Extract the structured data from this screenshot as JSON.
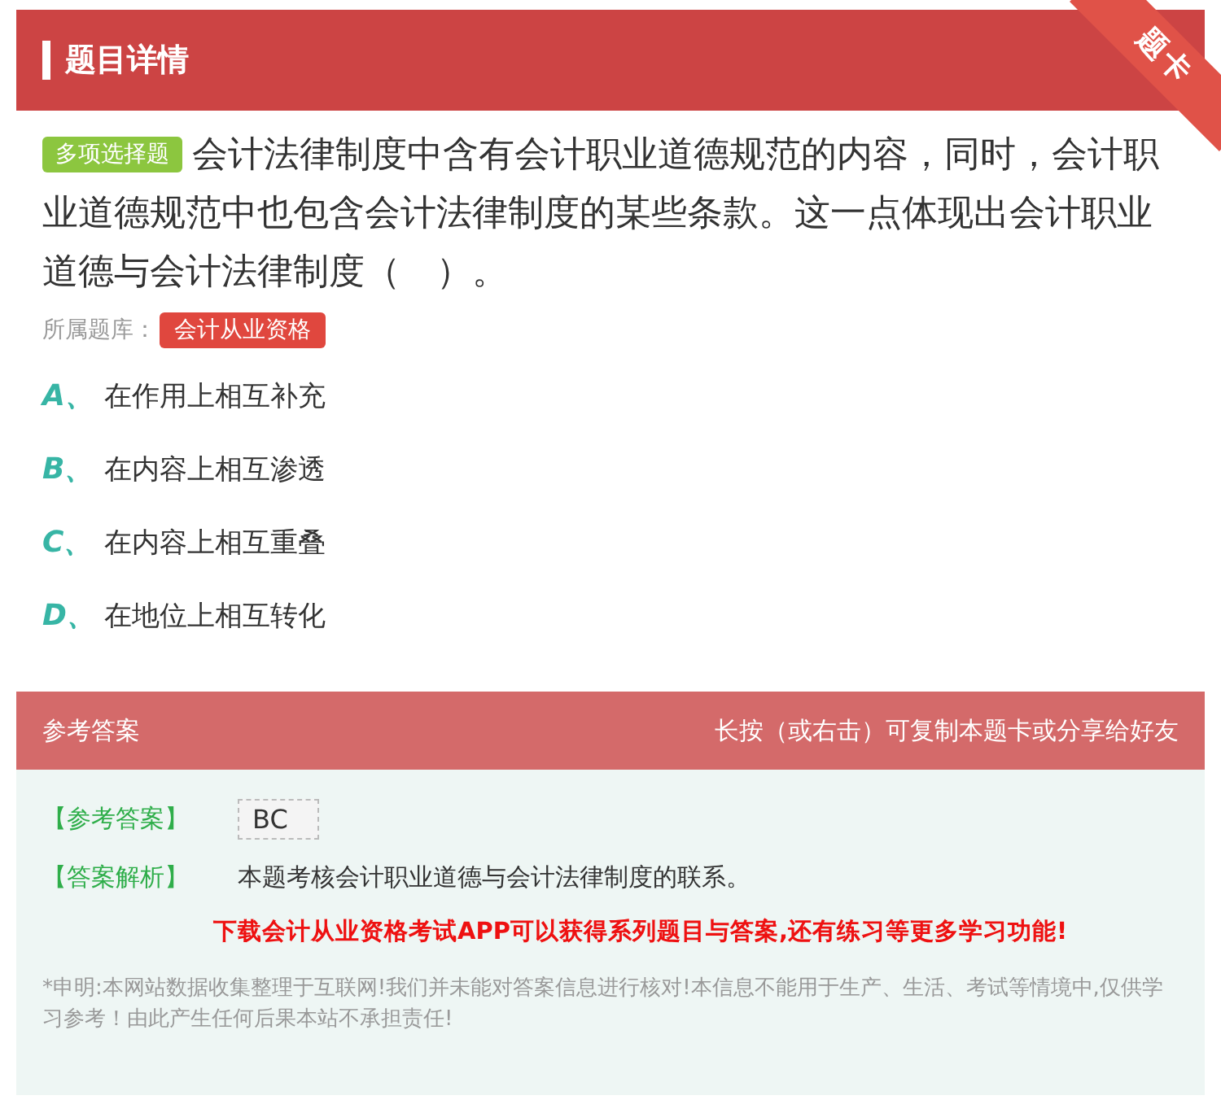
{
  "header": {
    "title": "题目详情",
    "corner_tag": "题卡"
  },
  "question": {
    "type_badge": "多项选择题",
    "text": "会计法律制度中含有会计职业道德规范的内容，同时，会计职业道德规范中也包含会计法律制度的某些条款。这一点体现出会计职业道德与会计法律制度（　）。",
    "bank_label": "所属题库：",
    "bank_tag": "会计从业资格"
  },
  "options": [
    {
      "letter": "A、",
      "text": "在作用上相互补充"
    },
    {
      "letter": "B、",
      "text": "在内容上相互渗透"
    },
    {
      "letter": "C、",
      "text": "在内容上相互重叠"
    },
    {
      "letter": "D、",
      "text": "在地位上相互转化"
    }
  ],
  "answer_bar": {
    "title": "参考答案",
    "hint": "长按（或右击）可复制本题卡或分享给好友"
  },
  "answer": {
    "answer_label": "【参考答案】",
    "answer_value": "BC",
    "analysis_label": "【答案解析】",
    "analysis_text": "本题考核会计职业道德与会计法律制度的联系。",
    "promo": "下载会计从业资格考试APP可以获得系列题目与答案,还有练习等更多学习功能!",
    "disclaimer": "*申明:本网站数据收集整理于互联网!我们并未能对答案信息进行核对!本信息不能用于生产、生活、考试等情境中,仅供学习参考！由此产生任何后果本站不承担责任!"
  }
}
